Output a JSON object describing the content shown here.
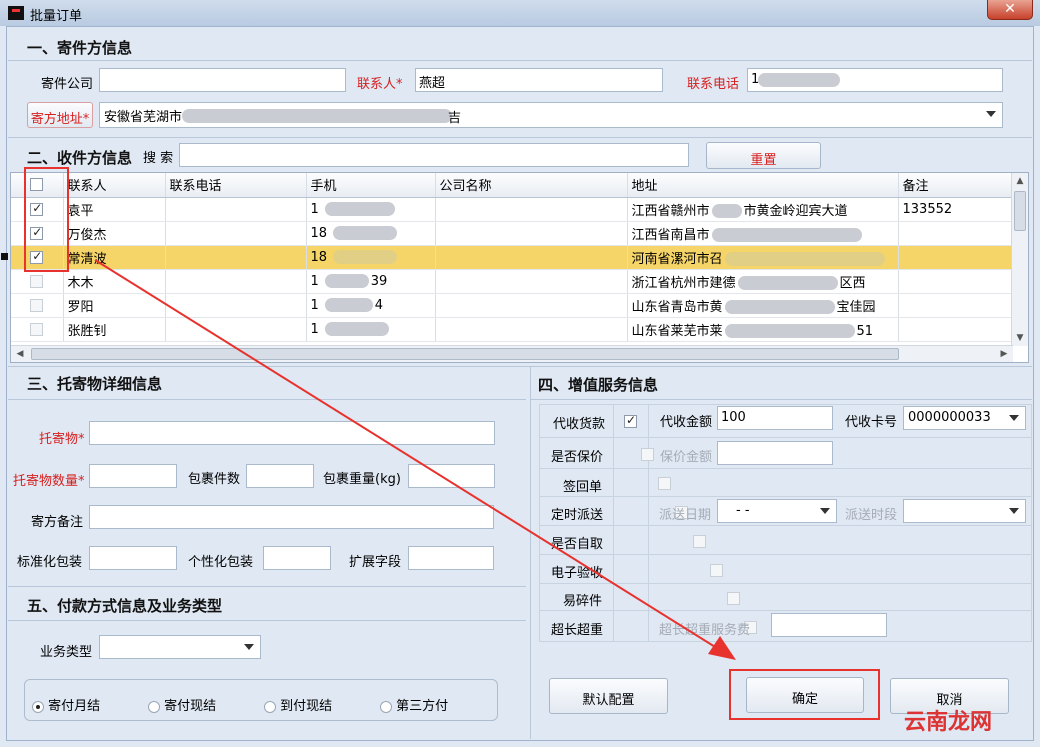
{
  "window": {
    "title": "批量订单",
    "close": "✕"
  },
  "sender": {
    "section_title": "一、寄件方信息",
    "company_label": "寄件公司",
    "company_value": "",
    "contact_label": "联系人*",
    "contact_value": "燕超",
    "phone_label": "联系电话",
    "phone_value": "1",
    "address_label": "寄方地址*",
    "address_value": "安徽省芜湖市",
    "address_tail": "吉"
  },
  "receiver": {
    "section_title": "二、收件方信息",
    "search_label": "搜 索",
    "search_value": "",
    "reset_label": "重置",
    "columns": [
      "联系人",
      "联系电话",
      "手机",
      "公司名称",
      "地址",
      "备注"
    ],
    "rows": [
      {
        "checked": true,
        "contact": "袁平",
        "tel": "",
        "mobile": "1",
        "company": "",
        "address": "江西省赣州市",
        "address_tail": "市黄金岭迎宾大道",
        "note": "133552"
      },
      {
        "checked": true,
        "contact": "万俊杰",
        "tel": "",
        "mobile": "18",
        "company": "",
        "address": "江西省南昌市",
        "address_tail": "",
        "note": ""
      },
      {
        "checked": true,
        "contact": "常清波",
        "tel": "",
        "mobile": "18",
        "company": "",
        "address": "河南省漯河市召",
        "address_tail": "",
        "note": ""
      },
      {
        "checked": false,
        "contact": "木木",
        "tel": "",
        "mobile": "1",
        "mobile_tail": "39",
        "company": "",
        "address": "浙江省杭州市建德",
        "address_tail": "区西",
        "note": ""
      },
      {
        "checked": false,
        "contact": "罗阳",
        "tel": "",
        "mobile": "1",
        "mobile_tail": "4",
        "company": "",
        "address": "山东省青岛市黄",
        "address_tail": "宝佳园",
        "note": ""
      },
      {
        "checked": false,
        "contact": "张胜钊",
        "tel": "",
        "mobile": "1",
        "company": "",
        "address": "山东省莱芜市莱",
        "address_tail": "51",
        "note": ""
      }
    ]
  },
  "cargo": {
    "section_title": "三、托寄物详细信息",
    "item_label": "托寄物*",
    "qty_label": "托寄物数量*",
    "pieces_label": "包裹件数",
    "weight_label": "包裹重量(kg)",
    "remark_label": "寄方备注",
    "std_pack_label": "标准化包装",
    "custom_pack_label": "个性化包装",
    "ext_label": "扩展字段"
  },
  "payment": {
    "section_title": "五、付款方式信息及业务类型",
    "biz_type_label": "业务类型",
    "biz_type_value": "",
    "options": [
      "寄付月结",
      "寄付现结",
      "到付现结",
      "第三方付"
    ],
    "selected": "寄付月结"
  },
  "services": {
    "section_title": "四、增值服务信息",
    "cod_label": "代收货款",
    "cod_amount_label": "代收金额",
    "cod_amount_value": "100",
    "cod_card_label": "代收卡号",
    "cod_card_value": "0000000033",
    "insure_label": "是否保价",
    "insure_amount_label": "保价金额",
    "sign_label": "签回单",
    "timed_label": "定时派送",
    "timed_date_label": "派送日期",
    "timed_date_value": "-  -",
    "timed_period_label": "派送时段",
    "self_pick_label": "是否自取",
    "e_inspect_label": "电子验收",
    "fragile_label": "易碎件",
    "oversize_label": "超长超重",
    "oversize_fee_label": "超长超重服务费"
  },
  "actions": {
    "default_config": "默认配置",
    "confirm": "确定",
    "cancel": "取消"
  },
  "watermark": "云南龙网"
}
